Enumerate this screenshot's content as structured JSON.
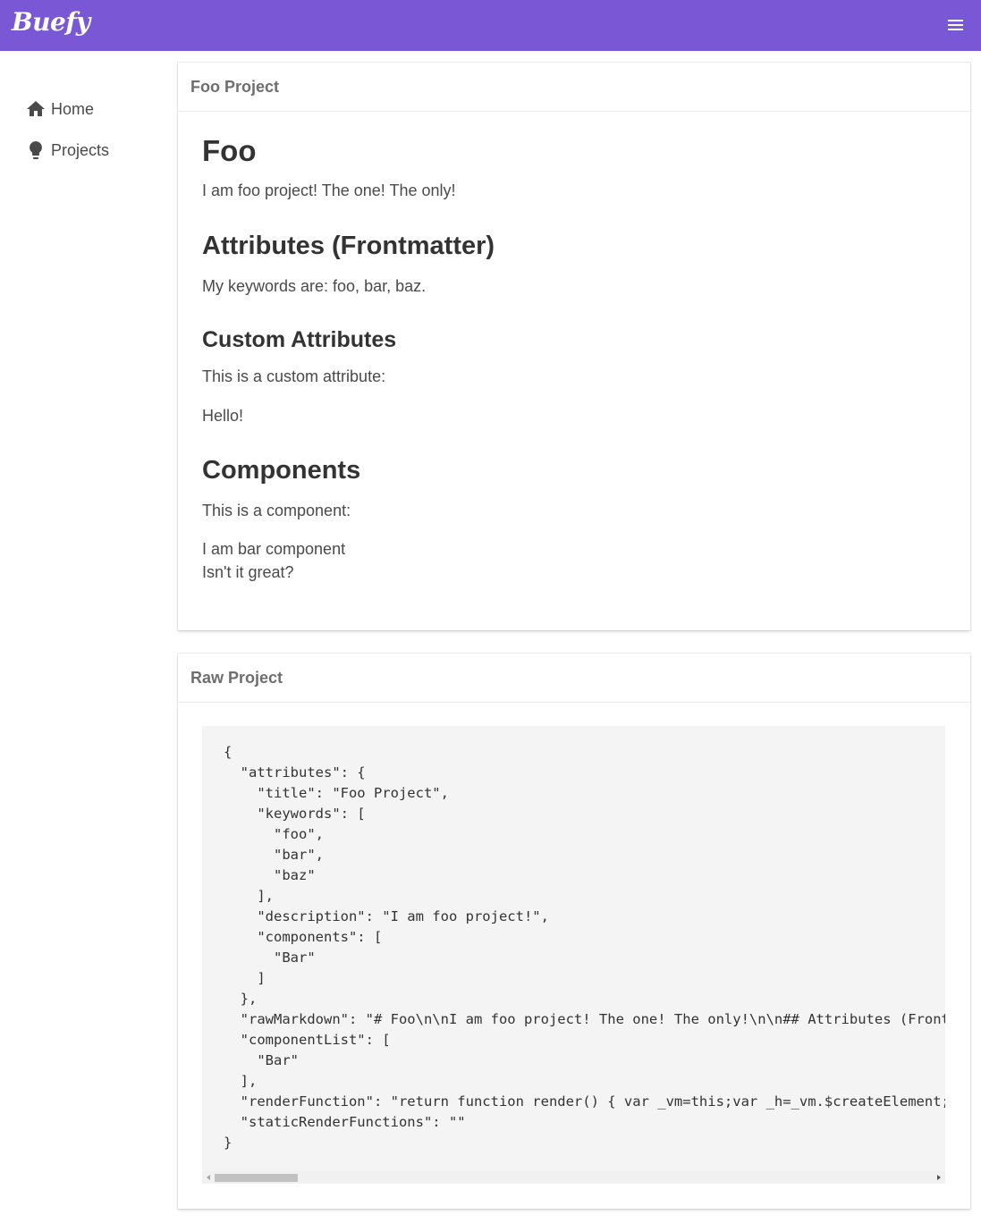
{
  "navbar": {
    "brand": "Buefy",
    "menu_icon": "hamburger-icon"
  },
  "sidebar": {
    "items": [
      {
        "label": "Home",
        "icon": "home-icon"
      },
      {
        "label": "Projects",
        "icon": "lightbulb-icon"
      }
    ]
  },
  "foo_card": {
    "header": "Foo Project",
    "h1": "Foo",
    "intro": "I am foo project! The one! The only!",
    "h2_attributes": "Attributes (Frontmatter)",
    "keywords_text": "My keywords are: foo, bar, baz.",
    "h3_custom": "Custom Attributes",
    "custom_text": "This is a custom attribute:",
    "custom_value": "Hello!",
    "h2_components": "Components",
    "component_text": "This is a component:",
    "bar_line1": "I am bar component",
    "bar_line2": "Isn't it great?"
  },
  "raw_card": {
    "header": "Raw Project",
    "code": "{\n  \"attributes\": {\n    \"title\": \"Foo Project\",\n    \"keywords\": [\n      \"foo\",\n      \"bar\",\n      \"baz\"\n    ],\n    \"description\": \"I am foo project!\",\n    \"components\": [\n      \"Bar\"\n    ]\n  },\n  \"rawMarkdown\": \"# Foo\\n\\nI am foo project! The one! The only!\\n\\n## Attributes (Frontmatter)\",\n  \"componentList\": [\n    \"Bar\"\n  ],\n  \"renderFunction\": \"return function render() { var _vm=this;var _h=_vm.$createElement;\",\n  \"staticRenderFunctions\": \"\"\n}"
  },
  "colors": {
    "navbar": "#7957d5",
    "code_bg": "#f4f4f4"
  }
}
